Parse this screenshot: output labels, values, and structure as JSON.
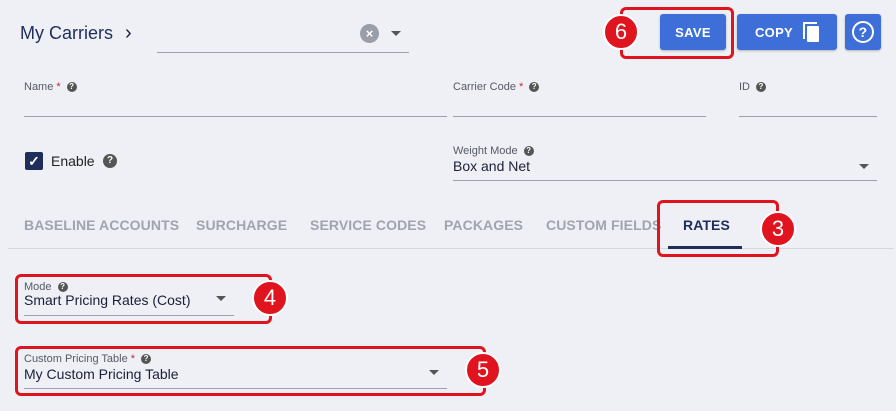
{
  "header": {
    "breadcrumb_title": "My Carriers",
    "breadcrumb_chevron": "›",
    "carrier_select_value": "",
    "clear_glyph": "×"
  },
  "toolbar": {
    "save_label": "SAVE",
    "copy_label": "COPY",
    "help_glyph": "?"
  },
  "form": {
    "name_label": "Name",
    "name_value": "",
    "carrier_code_label": "Carrier Code",
    "carrier_code_value": "",
    "id_label": "ID",
    "id_value": "",
    "required_mark": "*",
    "help_mark": "?",
    "enable_label": "Enable",
    "enable_checked": true,
    "check_glyph": "✓",
    "weight_mode_label": "Weight Mode",
    "weight_mode_value": "Box and Net"
  },
  "tabs": [
    {
      "label": "BASELINE ACCOUNTS",
      "active": false
    },
    {
      "label": "SURCHARGE",
      "active": false
    },
    {
      "label": "SERVICE CODES",
      "active": false
    },
    {
      "label": "PACKAGES",
      "active": false
    },
    {
      "label": "CUSTOM FIELDS",
      "active": false
    },
    {
      "label": "RATES",
      "active": true
    }
  ],
  "rates": {
    "mode_label": "Mode",
    "mode_value": "Smart Pricing Rates (Cost)",
    "pricing_table_label": "Custom Pricing Table",
    "pricing_table_value": "My Custom Pricing Table"
  },
  "annotations": {
    "badge_3": "3",
    "badge_4": "4",
    "badge_5": "5",
    "badge_6": "6"
  },
  "colors": {
    "primary_button": "#3e6fd8",
    "active_tab": "#1f2d5a",
    "highlight": "#e0141e",
    "background": "#eef0f6"
  }
}
